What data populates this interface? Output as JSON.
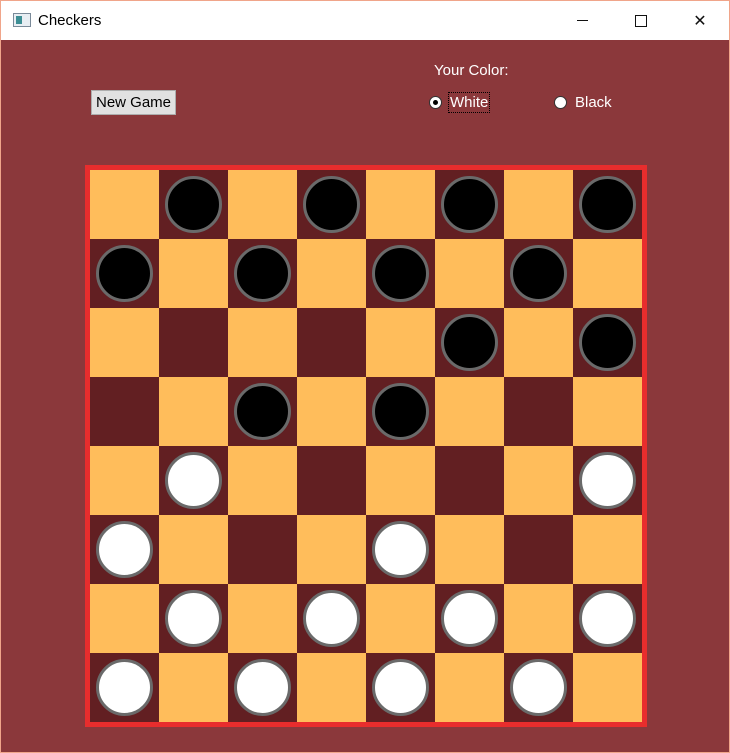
{
  "window": {
    "title": "Checkers"
  },
  "controls": {
    "new_game_label": "New Game",
    "color_label": "Your Color:",
    "options": [
      {
        "label": "White",
        "selected": true
      },
      {
        "label": "Black",
        "selected": false
      }
    ]
  },
  "colors": {
    "background": "#8b383b",
    "light_square": "#ffbd5b",
    "dark_square": "#621f22",
    "board_border": "#e82d2d"
  },
  "board": {
    "size": 8,
    "pieces": [
      [
        "",
        "b",
        "",
        "b",
        "",
        "b",
        "",
        "b"
      ],
      [
        "b",
        "",
        "b",
        "",
        "b",
        "",
        "b",
        ""
      ],
      [
        "",
        "",
        "",
        "",
        "",
        "b",
        "",
        "b"
      ],
      [
        "",
        "",
        "b",
        "",
        "b",
        "",
        "",
        ""
      ],
      [
        "",
        "w",
        "",
        "",
        "",
        "",
        "",
        "w"
      ],
      [
        "w",
        "",
        "",
        "",
        "w",
        "",
        "",
        ""
      ],
      [
        "",
        "w",
        "",
        "w",
        "",
        "w",
        "",
        "w"
      ],
      [
        "w",
        "",
        "w",
        "",
        "w",
        "",
        "w",
        ""
      ]
    ]
  }
}
